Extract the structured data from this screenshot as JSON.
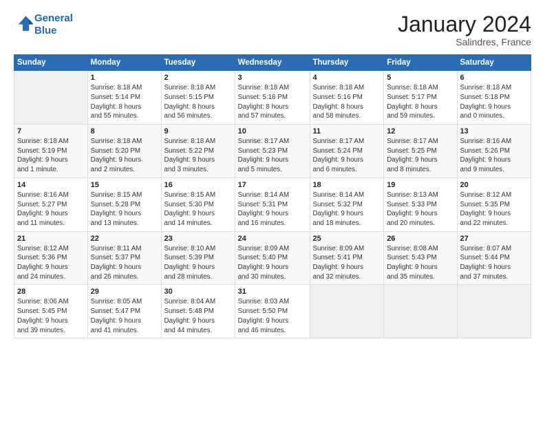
{
  "logo": {
    "line1": "General",
    "line2": "Blue"
  },
  "header": {
    "month": "January 2024",
    "location": "Salindres, France"
  },
  "days_of_week": [
    "Sunday",
    "Monday",
    "Tuesday",
    "Wednesday",
    "Thursday",
    "Friday",
    "Saturday"
  ],
  "weeks": [
    [
      {
        "day": "",
        "info": ""
      },
      {
        "day": "1",
        "info": "Sunrise: 8:18 AM\nSunset: 5:14 PM\nDaylight: 8 hours\nand 55 minutes."
      },
      {
        "day": "2",
        "info": "Sunrise: 8:18 AM\nSunset: 5:15 PM\nDaylight: 8 hours\nand 56 minutes."
      },
      {
        "day": "3",
        "info": "Sunrise: 8:18 AM\nSunset: 5:16 PM\nDaylight: 8 hours\nand 57 minutes."
      },
      {
        "day": "4",
        "info": "Sunrise: 8:18 AM\nSunset: 5:16 PM\nDaylight: 8 hours\nand 58 minutes."
      },
      {
        "day": "5",
        "info": "Sunrise: 8:18 AM\nSunset: 5:17 PM\nDaylight: 8 hours\nand 59 minutes."
      },
      {
        "day": "6",
        "info": "Sunrise: 8:18 AM\nSunset: 5:18 PM\nDaylight: 9 hours\nand 0 minutes."
      }
    ],
    [
      {
        "day": "7",
        "info": "Sunrise: 8:18 AM\nSunset: 5:19 PM\nDaylight: 9 hours\nand 1 minute."
      },
      {
        "day": "8",
        "info": "Sunrise: 8:18 AM\nSunset: 5:20 PM\nDaylight: 9 hours\nand 2 minutes."
      },
      {
        "day": "9",
        "info": "Sunrise: 8:18 AM\nSunset: 5:22 PM\nDaylight: 9 hours\nand 3 minutes."
      },
      {
        "day": "10",
        "info": "Sunrise: 8:17 AM\nSunset: 5:23 PM\nDaylight: 9 hours\nand 5 minutes."
      },
      {
        "day": "11",
        "info": "Sunrise: 8:17 AM\nSunset: 5:24 PM\nDaylight: 9 hours\nand 6 minutes."
      },
      {
        "day": "12",
        "info": "Sunrise: 8:17 AM\nSunset: 5:25 PM\nDaylight: 9 hours\nand 8 minutes."
      },
      {
        "day": "13",
        "info": "Sunrise: 8:16 AM\nSunset: 5:26 PM\nDaylight: 9 hours\nand 9 minutes."
      }
    ],
    [
      {
        "day": "14",
        "info": "Sunrise: 8:16 AM\nSunset: 5:27 PM\nDaylight: 9 hours\nand 11 minutes."
      },
      {
        "day": "15",
        "info": "Sunrise: 8:15 AM\nSunset: 5:28 PM\nDaylight: 9 hours\nand 13 minutes."
      },
      {
        "day": "16",
        "info": "Sunrise: 8:15 AM\nSunset: 5:30 PM\nDaylight: 9 hours\nand 14 minutes."
      },
      {
        "day": "17",
        "info": "Sunrise: 8:14 AM\nSunset: 5:31 PM\nDaylight: 9 hours\nand 16 minutes."
      },
      {
        "day": "18",
        "info": "Sunrise: 8:14 AM\nSunset: 5:32 PM\nDaylight: 9 hours\nand 18 minutes."
      },
      {
        "day": "19",
        "info": "Sunrise: 8:13 AM\nSunset: 5:33 PM\nDaylight: 9 hours\nand 20 minutes."
      },
      {
        "day": "20",
        "info": "Sunrise: 8:12 AM\nSunset: 5:35 PM\nDaylight: 9 hours\nand 22 minutes."
      }
    ],
    [
      {
        "day": "21",
        "info": "Sunrise: 8:12 AM\nSunset: 5:36 PM\nDaylight: 9 hours\nand 24 minutes."
      },
      {
        "day": "22",
        "info": "Sunrise: 8:11 AM\nSunset: 5:37 PM\nDaylight: 9 hours\nand 26 minutes."
      },
      {
        "day": "23",
        "info": "Sunrise: 8:10 AM\nSunset: 5:39 PM\nDaylight: 9 hours\nand 28 minutes."
      },
      {
        "day": "24",
        "info": "Sunrise: 8:09 AM\nSunset: 5:40 PM\nDaylight: 9 hours\nand 30 minutes."
      },
      {
        "day": "25",
        "info": "Sunrise: 8:09 AM\nSunset: 5:41 PM\nDaylight: 9 hours\nand 32 minutes."
      },
      {
        "day": "26",
        "info": "Sunrise: 8:08 AM\nSunset: 5:43 PM\nDaylight: 9 hours\nand 35 minutes."
      },
      {
        "day": "27",
        "info": "Sunrise: 8:07 AM\nSunset: 5:44 PM\nDaylight: 9 hours\nand 37 minutes."
      }
    ],
    [
      {
        "day": "28",
        "info": "Sunrise: 8:06 AM\nSunset: 5:45 PM\nDaylight: 9 hours\nand 39 minutes."
      },
      {
        "day": "29",
        "info": "Sunrise: 8:05 AM\nSunset: 5:47 PM\nDaylight: 9 hours\nand 41 minutes."
      },
      {
        "day": "30",
        "info": "Sunrise: 8:04 AM\nSunset: 5:48 PM\nDaylight: 9 hours\nand 44 minutes."
      },
      {
        "day": "31",
        "info": "Sunrise: 8:03 AM\nSunset: 5:50 PM\nDaylight: 9 hours\nand 46 minutes."
      },
      {
        "day": "",
        "info": ""
      },
      {
        "day": "",
        "info": ""
      },
      {
        "day": "",
        "info": ""
      }
    ]
  ]
}
